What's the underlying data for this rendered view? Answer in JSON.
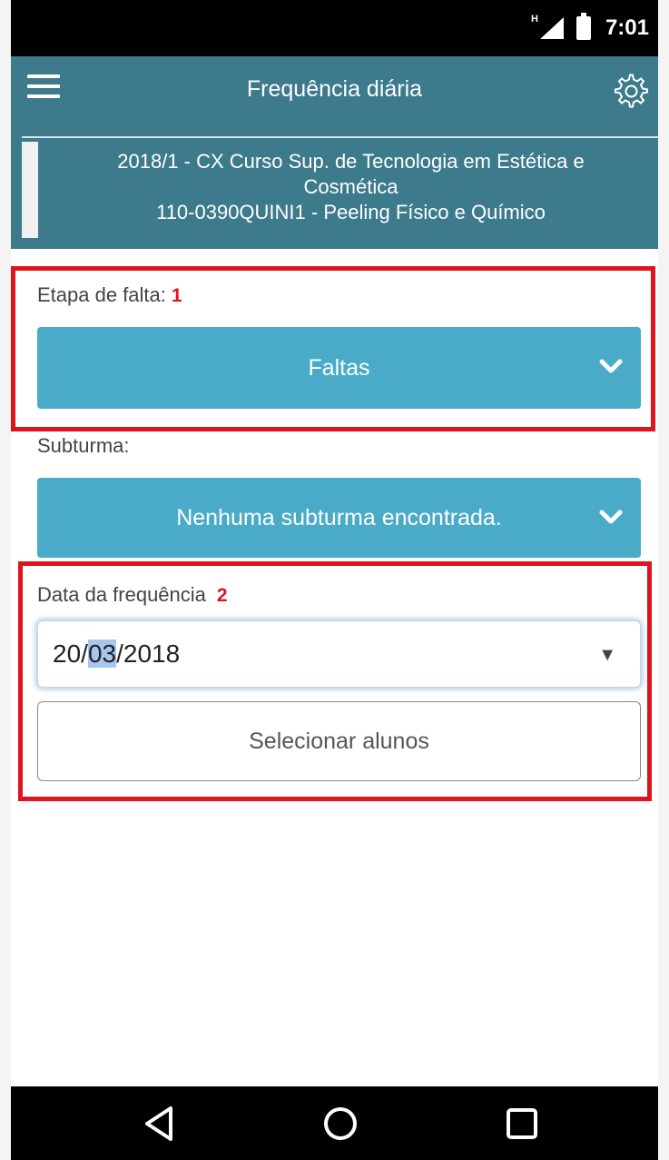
{
  "status_bar": {
    "time": "7:01",
    "network_type": "H",
    "icons": [
      "signal-icon",
      "battery-icon"
    ]
  },
  "app_bar": {
    "title": "Frequência diária",
    "menu_icon": "hamburger-menu-icon",
    "settings_icon": "gear-icon"
  },
  "course_info": {
    "line1": "2018/1 - CX Curso Sup. de Tecnologia em Estética e",
    "line2": "Cosmética",
    "line3": "110-0390QUINI1 - Peeling Físico e Químico"
  },
  "etapa": {
    "label": "Etapa de falta:",
    "marker": "1",
    "selected": "Faltas",
    "icon": "chevron-down-icon"
  },
  "subturma": {
    "label": "Subturma:",
    "selected": "Nenhuma subturma encontrada.",
    "icon": "chevron-down-icon"
  },
  "data_frequencia": {
    "label": "Data da frequência",
    "marker": "2",
    "day": "20",
    "month": "03",
    "year": "2018",
    "sep": "/",
    "icon": "dropdown-arrow-icon"
  },
  "select_students_button": "Selecionar alunos",
  "nav_bar": {
    "icons": [
      "back-icon",
      "home-icon",
      "recents-icon"
    ]
  },
  "colors": {
    "app_bar": "#3c7a8c",
    "dropdown": "#4aabc8",
    "annotation": "#e0141e",
    "date_highlight": "#a9c6ee"
  }
}
